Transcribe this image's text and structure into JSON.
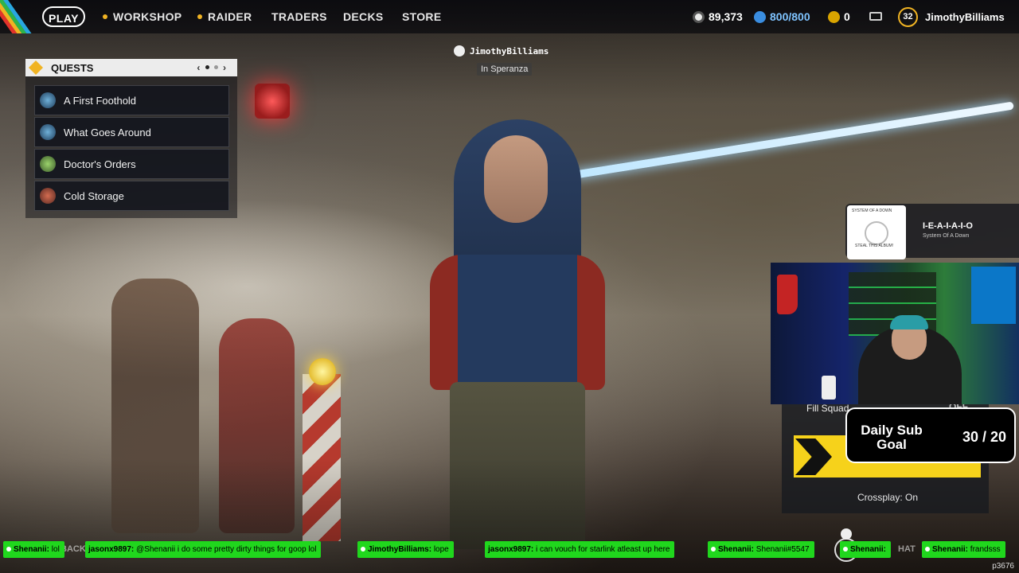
{
  "topnav": {
    "play_label": "PLAY",
    "items": [
      "WORKSHOP",
      "RAIDER",
      "TRADERS",
      "DECKS",
      "STORE"
    ],
    "currency1": "89,373",
    "currency2": "800/800",
    "currency3": "0",
    "level": "32",
    "username": "JimothyBilliams",
    "accent_color": "#f0b323"
  },
  "quests": {
    "title": "QUESTS",
    "pager_prev": "‹",
    "pager_next": "›",
    "items": [
      {
        "label": "A First Foothold",
        "icon": "quest-globe-icon"
      },
      {
        "label": "What Goes Around",
        "icon": "quest-globe-icon"
      },
      {
        "label": "Doctor's Orders",
        "icon": "quest-medic-icon"
      },
      {
        "label": "Cold Storage",
        "icon": "quest-storage-icon"
      }
    ]
  },
  "player": {
    "name": "JimothyBilliams",
    "location": "In Speranza"
  },
  "now_playing": {
    "song": "I-E-A-I-A-I-O",
    "artist": "System Of A Down",
    "album_art_top": "SYSTEM OF A DOWN",
    "album_art_bottom": "STEAL THIS ALBUM!"
  },
  "lobby": {
    "fill_squad": "Fill Squad",
    "fill_state": "OFF",
    "crossplay": "Crossplay: On"
  },
  "sub_goal": {
    "title": "Daily Sub Goal",
    "value": "30 / 20"
  },
  "chat": [
    {
      "user": "Shenanii:",
      "text": "lol"
    },
    {
      "user": "jasonx9897:",
      "text": "@Shenanii i do some pretty dirty things for goop lol"
    },
    {
      "user": "JimothyBilliams:",
      "text": "lope"
    },
    {
      "user": "jasonx9897:",
      "text": "i can vouch for starlink atleast up here"
    },
    {
      "user": "Shenanii:",
      "text": "Shenanii#5547"
    },
    {
      "user": "Shenanii:",
      "text": ""
    },
    {
      "user": "Shenanii:",
      "text": "frandsss"
    }
  ],
  "ghost_labels": [
    "BACK",
    "HAT"
  ],
  "corner_id": "p3676",
  "chat_color": "#20d71d"
}
